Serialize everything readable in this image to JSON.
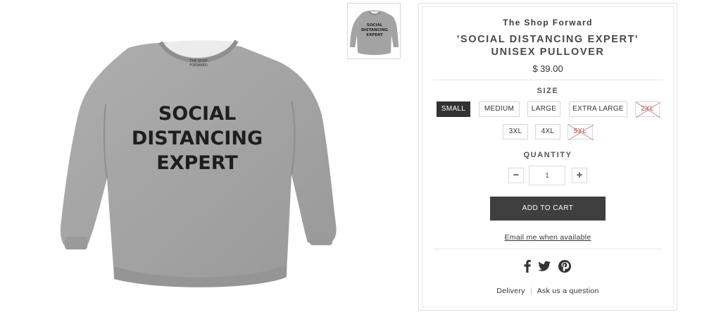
{
  "product": {
    "shop_name": "The Shop Forward",
    "title_line1": "'SOCIAL DISTANCING EXPERT'",
    "title_line2": "UNISEX PULLOVER",
    "price": "$ 39.00",
    "image_text": {
      "collar_label_line1": "THE SHOP",
      "collar_label_line2": "FORWARD",
      "line1": "SOCIAL",
      "line2": "DISTANCING",
      "line3": "EXPERT"
    }
  },
  "size": {
    "label": "SIZE",
    "options": [
      {
        "label": "SMALL",
        "state": "selected"
      },
      {
        "label": "MEDIUM",
        "state": "available"
      },
      {
        "label": "LARGE",
        "state": "available"
      },
      {
        "label": "EXTRA LARGE",
        "state": "available"
      },
      {
        "label": "2XL",
        "state": "unavailable"
      },
      {
        "label": "3XL",
        "state": "available"
      },
      {
        "label": "4XL",
        "state": "available"
      },
      {
        "label": "5XL",
        "state": "unavailable"
      }
    ]
  },
  "quantity": {
    "label": "QUANTITY",
    "value": "1",
    "minus": "−",
    "plus": "+"
  },
  "actions": {
    "add_to_cart": "ADD TO CART",
    "email_when_available": "Email me when available"
  },
  "social": {
    "icons": [
      "facebook-icon",
      "twitter-icon",
      "pinterest-icon"
    ]
  },
  "footer": {
    "delivery": "Delivery",
    "ask": "Ask us a question"
  },
  "colors": {
    "sweater_gray": "#a3a3a3",
    "print_black": "#1e1e1e",
    "button_dark": "#3f3f3f",
    "unavailable_red": "#b04a4a"
  }
}
